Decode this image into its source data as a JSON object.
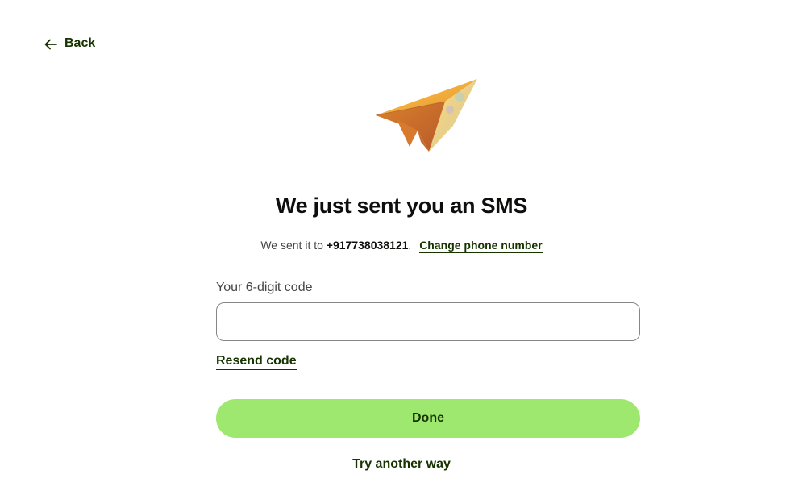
{
  "nav": {
    "back_label": "Back"
  },
  "header": {
    "title": "We just sent you an SMS"
  },
  "sent_info": {
    "prefix": "We sent it to",
    "phone": "+917738038121",
    "suffix": ".",
    "change_link": "Change phone number"
  },
  "form": {
    "code_label": "Your 6-digit code",
    "code_value": "",
    "resend_label": "Resend code"
  },
  "actions": {
    "done_label": "Done",
    "try_another_label": "Try another way"
  },
  "icons": {
    "back": "arrow-left-icon",
    "illustration": "paper-plane-icon"
  },
  "colors": {
    "accent_green": "#9fe870",
    "link_dark_green": "#163300",
    "text_primary": "#0e0f0c",
    "text_secondary": "#454745",
    "input_border": "#868685"
  }
}
